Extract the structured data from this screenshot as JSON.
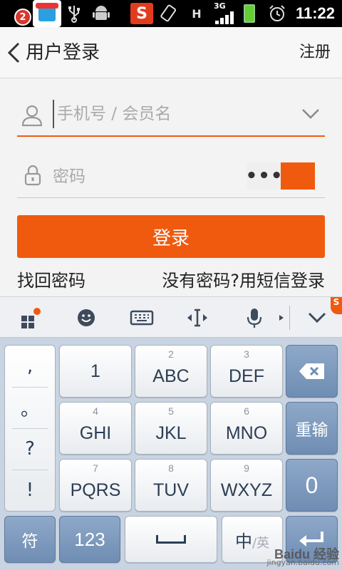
{
  "status_bar": {
    "notification_count": "2",
    "network": "3G",
    "time": "11:22"
  },
  "header": {
    "title": "用户登录",
    "register": "注册"
  },
  "form": {
    "username_placeholder": "手机号 / 会员名",
    "password_placeholder": "密码",
    "password_toggle_dots": "•••",
    "login_button": "登录",
    "forgot_password": "找回密码",
    "sms_login": "没有密码?用短信登录"
  },
  "keyboard": {
    "punctuation": [
      ",",
      "。",
      "?",
      "!"
    ],
    "keys": {
      "k1": {
        "num": "",
        "label": "1"
      },
      "k2": {
        "num": "2",
        "label": "ABC"
      },
      "k3": {
        "num": "3",
        "label": "DEF"
      },
      "k4": {
        "num": "4",
        "label": "GHI"
      },
      "k5": {
        "num": "5",
        "label": "JKL"
      },
      "k6": {
        "num": "6",
        "label": "MNO"
      },
      "k7": {
        "num": "7",
        "label": "PQRS"
      },
      "k8": {
        "num": "8",
        "label": "TUV"
      },
      "k9": {
        "num": "9",
        "label": "WXYZ"
      },
      "k0": {
        "num": "",
        "label": "0"
      }
    },
    "reenter": "重输",
    "symbols": "符",
    "numbers": "123",
    "ime_main": "中",
    "ime_sub": "/英"
  },
  "watermark": {
    "main": "Baidu 经验",
    "sub": "jingyan.baidu.com"
  },
  "colors": {
    "accent": "#f05a0e",
    "key_dark": "#7b97bb"
  }
}
